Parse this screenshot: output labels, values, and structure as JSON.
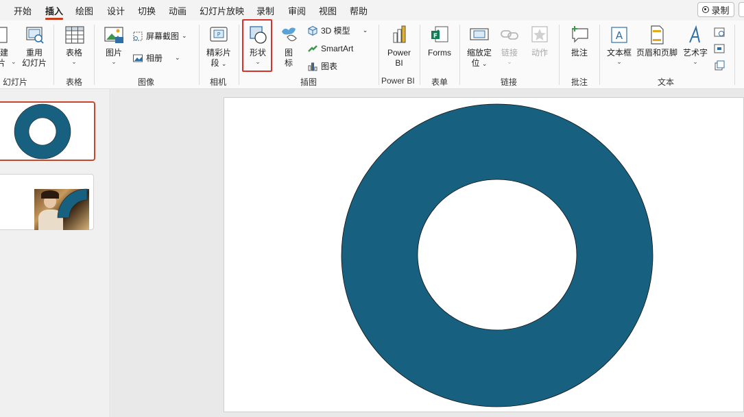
{
  "menu": {
    "tabs": [
      "开始",
      "插入",
      "绘图",
      "设计",
      "切换",
      "动画",
      "幻灯片放映",
      "录制",
      "审阅",
      "视图",
      "帮助"
    ],
    "active_tab": "插入",
    "record_label": "录制"
  },
  "ribbon": {
    "new_slide_partial": [
      "建",
      "片"
    ],
    "reuse_slide": [
      "重用",
      "幻灯片"
    ],
    "table": "表格",
    "picture": "图片",
    "screenshot": "屏幕截图",
    "album": "相册",
    "highlight_clips": [
      "精彩片",
      "段"
    ],
    "shapes": "形状",
    "icons": [
      "图",
      "标"
    ],
    "model_3d": "3D 模型",
    "smartart": "SmartArt",
    "chart": "图表",
    "power_bi": [
      "Power",
      "BI"
    ],
    "forms": "Forms",
    "zoom": [
      "缩放定",
      "位"
    ],
    "link": "链接",
    "action": "动作",
    "comment": "批注",
    "textbox": "文本框",
    "header_footer": "页眉和页脚",
    "wordart": "艺术字",
    "groups": {
      "slides": "幻灯片",
      "tables": "表格",
      "images": "图像",
      "camera": "相机",
      "illustrations": "插图",
      "powerbi": "Power BI",
      "forms": "表单",
      "links": "链接",
      "comments": "批注",
      "text": "文本"
    }
  },
  "colors": {
    "shape_fill": "#17607f",
    "accent_red": "#d9302a",
    "tab_underline": "#c43e1c"
  },
  "icons": [
    "new-slide-icon",
    "reuse-slide-icon",
    "table-icon",
    "picture-icon",
    "screenshot-icon",
    "album-icon",
    "highlight-clips-icon",
    "shapes-icon",
    "icons-icon",
    "cube-icon",
    "smartart-icon",
    "chart-icon",
    "powerbi-icon",
    "forms-icon",
    "zoom-icon",
    "link-icon",
    "action-icon",
    "comment-icon",
    "textbox-icon",
    "header-footer-icon",
    "wordart-icon",
    "date-icon",
    "slide-number-icon",
    "object-icon"
  ]
}
